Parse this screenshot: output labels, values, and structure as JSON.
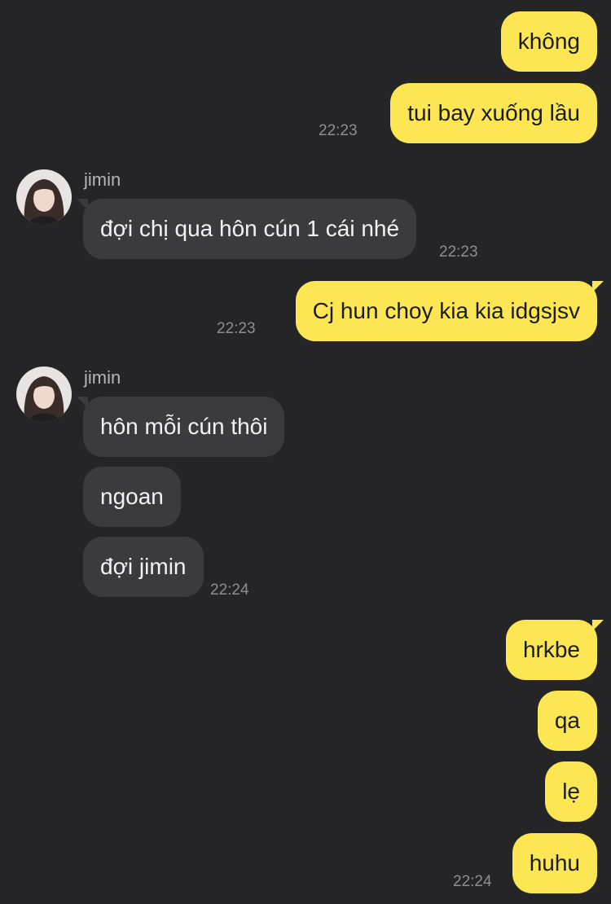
{
  "chat": {
    "contact_name": "jimin",
    "messages": [
      {
        "dir": "out",
        "text": "không"
      },
      {
        "dir": "out",
        "text": "tui bay xuống lầu",
        "time": "22:23"
      },
      {
        "dir": "in",
        "text": "đợi chị qua hôn cún 1 cái nhé",
        "time": "22:23"
      },
      {
        "dir": "out",
        "text": "Cj hun choy kia kia idgsjsv",
        "time": "22:23"
      },
      {
        "dir": "in",
        "text": "hôn mỗi cún thôi"
      },
      {
        "dir": "in",
        "text": "ngoan"
      },
      {
        "dir": "in",
        "text": "đợi jimin",
        "time": "22:24"
      },
      {
        "dir": "out",
        "text": "hrkbe"
      },
      {
        "dir": "out",
        "text": "qa"
      },
      {
        "dir": "out",
        "text": "lẹ"
      },
      {
        "dir": "out",
        "text": "huhu",
        "time": "22:24"
      }
    ]
  },
  "colors": {
    "background": "#252527",
    "outgoing_bubble": "#fce653",
    "incoming_bubble": "#3b3b3e",
    "timestamp": "#8e8e92"
  },
  "icons": {
    "avatar": "profile-photo"
  }
}
